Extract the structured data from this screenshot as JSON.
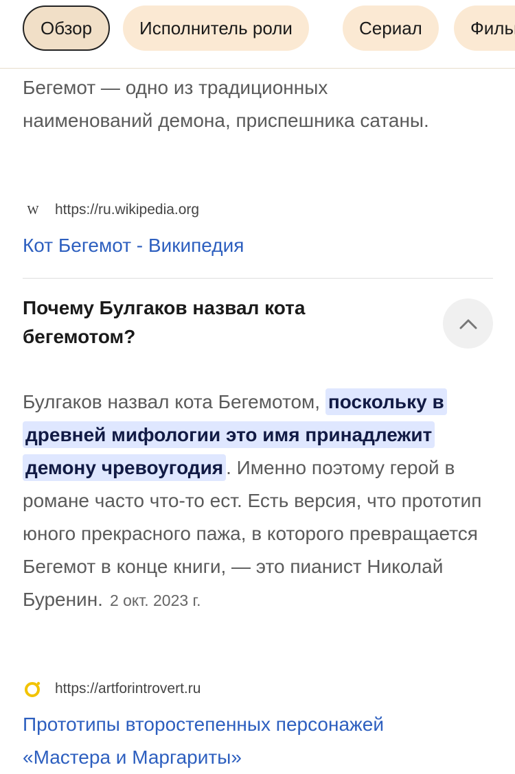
{
  "filters": {
    "chips": [
      {
        "label": "Обзор",
        "active": true
      },
      {
        "label": "Исполнитель роли",
        "active": false
      },
      {
        "label": "Сериал",
        "active": false
      },
      {
        "label": "Фильм",
        "active": false
      }
    ]
  },
  "result1": {
    "snippet": "Бегемот — одно из традиционных наименований демона, приспешника сатаны.",
    "favicon_icon": "wikipedia-w-icon",
    "source_url": "https://ru.wikipedia.org",
    "title": "Кот Бегемот - Википедия"
  },
  "faq": {
    "question": "Почему Булгаков назвал кота бегемотом?",
    "toggle_icon": "chevron-up-icon",
    "answer_before": "Булгаков назвал кота Бегемотом, ",
    "answer_highlight": "поскольку в древней мифологии это имя принадлежит демону чревоугодия",
    "answer_after": ". Именно поэтому герой в романе часто что-то ест. Есть версия, что прототип юного прекрасного пажа, в которого превращается Бегемот в конце книги, — это пианист Николай Буренин.",
    "date": "2 окт. 2023 г."
  },
  "result2": {
    "favicon_icon": "ring-logo-icon",
    "source_url": "https://artforintrovert.ru",
    "title": "Прототипы второстепенных персонажей «Мастера и Маргариты»"
  },
  "colors": {
    "link": "#2d5fbf",
    "chip_bg": "#fbe9d3",
    "highlight_bg": "#dfe7ff"
  }
}
